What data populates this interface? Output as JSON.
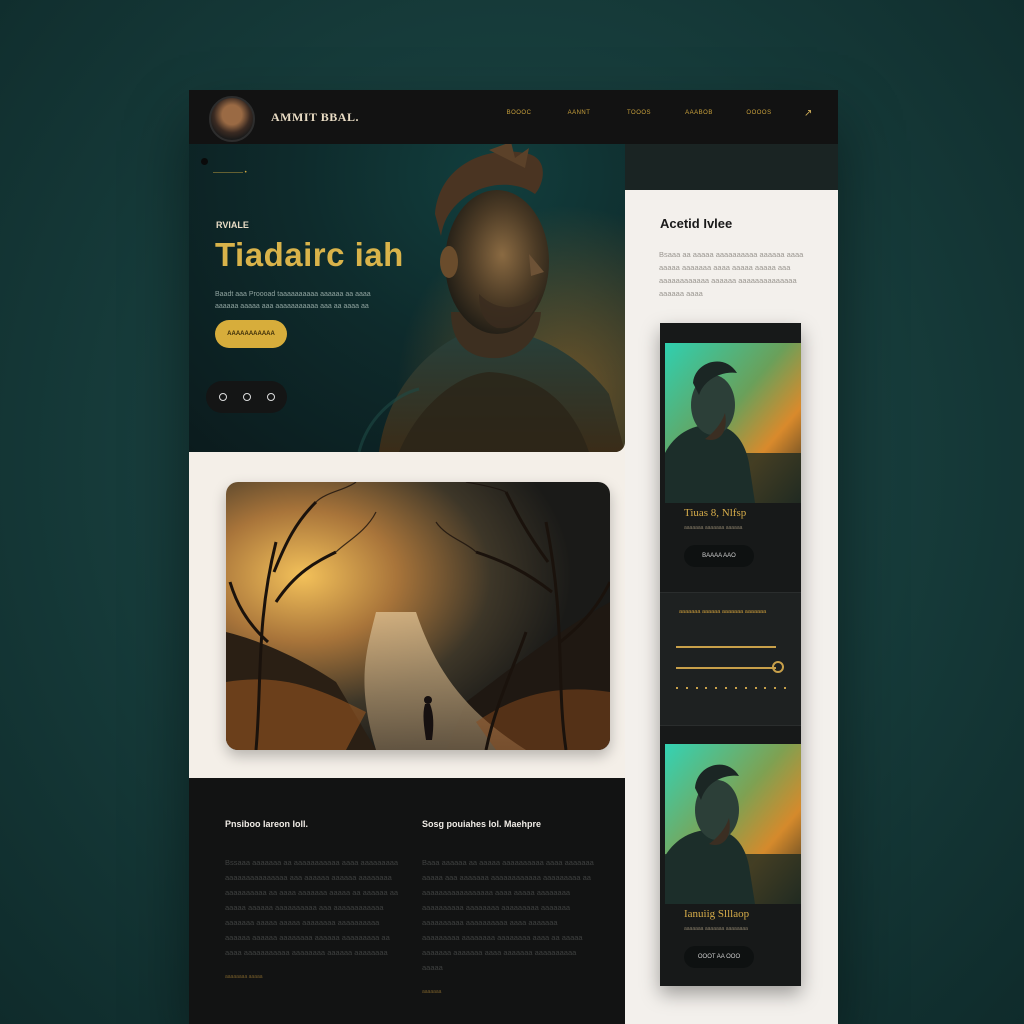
{
  "nav": {
    "brand": "AMMIT BBAL.",
    "links": [
      "BOOOC",
      "AANNT",
      "TOOOS",
      "AAABOB",
      "OOOOS"
    ],
    "arrow": "↗"
  },
  "hero": {
    "eyebrow": "————— •",
    "kicker": "RVIALE",
    "title": "Tiadairc iah",
    "description": "Baadt aaa Proooad taaaaaaaaaa aaaaaa aa aaaa aaaaaa aaaaa aaa aaaaaaaaaaa aaa aa aaaa aa",
    "cta": "AAAAAAAAAAA",
    "pager_dots": 3
  },
  "sidebar": {
    "title": "Acetid Ivlee",
    "description": "Bsaaa aa aaaaa aaaaaaaaaa aaaaaa aaaa aaaaa aaaaaaa aaaa aaaaa aaaaa aaa aaaaaaaaaaaa aaaaaa aaaaaaaaaaaaaa aaaaaa aaaa",
    "card1": {
      "title": "Tiuas 8, Nlfsp",
      "caption": "aaaaaaa aaaaaaa aaaaaa",
      "button": "BAAAA AAO"
    },
    "player": {
      "label": "aaaaaaa aaaaaa aaaaaaa aaaaaaa"
    },
    "card2": {
      "title": "Ianuiig Slllaop",
      "caption": "aaaaaaa aaaaaaa aaaaaaaa",
      "button": "OOOT AA OOO"
    }
  },
  "footer": {
    "col1": {
      "title": "Pnsiboo Iareon Ioll.",
      "text": "Bssaaa aaaaaaa aa aaaaaaaaaaa aaaa aaaaaaaaa aaaaaaaaaaaaaaa aaa aaaaaa aaaaaa aaaaaaaa aaaaaaaaaa aa aaaa aaaaaaa aaaaa aa aaaaaa aa aaaaa aaaaaa aaaaaaaaaa aaa aaaaaaaaaaaa aaaaaaa aaaaa aaaaa aaaaaaaa aaaaaaaaaa aaaaaa aaaaaa aaaaaaaa aaaaaa aaaaaaaaa aa aaaa aaaaaaaaaaa aaaaaaaa aaaaaa aaaaaaaa",
      "small": "aaaaaaaa aaaaa"
    },
    "col2": {
      "title": "Sosg pouiahes Iol. Maehpre",
      "text": "Baaa aaaaaa aa aaaaa aaaaaaaaaa aaaa aaaaaaa aaaaa aaa aaaaaaa aaaaaaaaaaaa aaaaaaaaa aa aaaaaaaaaaaaaaaaa aaaa aaaaa aaaaaaaa aaaaaaaaaa aaaaaaaa aaaaaaaaa aaaaaaa aaaaaaaaaa aaaaaaaaaa aaaa aaaaaaa aaaaaaaaa aaaaaaaa aaaaaaaa aaaa aa aaaaa aaaaaaa aaaaaaa aaaa aaaaaaa aaaaaaaaaa aaaaa",
      "small": "aaaaaaa"
    }
  },
  "colors": {
    "accent": "#d9b34a",
    "nav_bg": "#121212",
    "page_bg": "#f4efe8",
    "outer_bg": "#1c4443"
  }
}
